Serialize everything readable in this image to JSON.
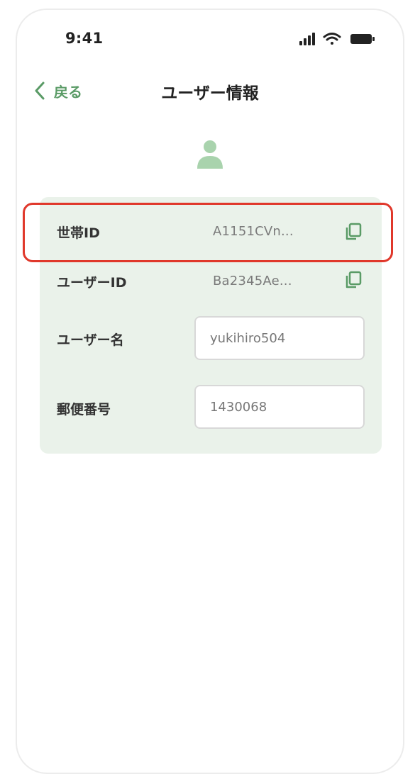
{
  "status_bar": {
    "time": "9:41",
    "icons": [
      "signal-icon",
      "wifi-icon",
      "battery-icon"
    ]
  },
  "nav": {
    "back_label": "戻る",
    "title": "ユーザー情報"
  },
  "colors": {
    "accent": "#5a9b66",
    "card_bg": "#eaf2ea",
    "highlight": "#e0382b"
  },
  "fields": {
    "household_id": {
      "label": "世帯ID",
      "value": "A1151CVn..."
    },
    "user_id": {
      "label": "ユーザーID",
      "value": "Ba2345Ae..."
    },
    "username": {
      "label": "ユーザー名",
      "value": "yukihiro504"
    },
    "postal_code": {
      "label": "郵便番号",
      "value": "1430068"
    }
  }
}
